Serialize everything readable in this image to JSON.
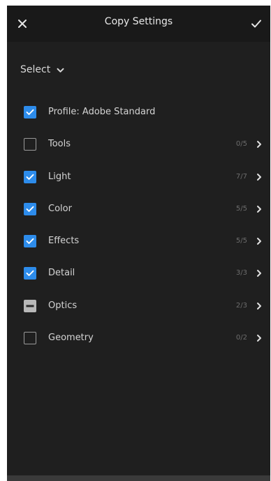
{
  "header": {
    "title": "Copy Settings",
    "close_icon": "close-icon",
    "confirm_icon": "checkmark-icon"
  },
  "select": {
    "label": "Select",
    "icon": "chevron-down-icon"
  },
  "colors": {
    "background": "#1f1f1f",
    "header": "#191919",
    "checkbox_checked": "#2d8ceb",
    "text": "#d4d4d4",
    "count": "#6d6d6d"
  },
  "items": [
    {
      "label": "Profile: Adobe Standard",
      "state": "checked",
      "count": "",
      "has_chevron": false
    },
    {
      "label": "Tools",
      "state": "unchecked",
      "count": "0/5",
      "has_chevron": true
    },
    {
      "label": "Light",
      "state": "checked",
      "count": "7/7",
      "has_chevron": true
    },
    {
      "label": "Color",
      "state": "checked",
      "count": "5/5",
      "has_chevron": true
    },
    {
      "label": "Effects",
      "state": "checked",
      "count": "5/5",
      "has_chevron": true
    },
    {
      "label": "Detail",
      "state": "checked",
      "count": "3/3",
      "has_chevron": true
    },
    {
      "label": "Optics",
      "state": "mixed",
      "count": "2/3",
      "has_chevron": true
    },
    {
      "label": "Geometry",
      "state": "unchecked",
      "count": "0/2",
      "has_chevron": true
    }
  ]
}
